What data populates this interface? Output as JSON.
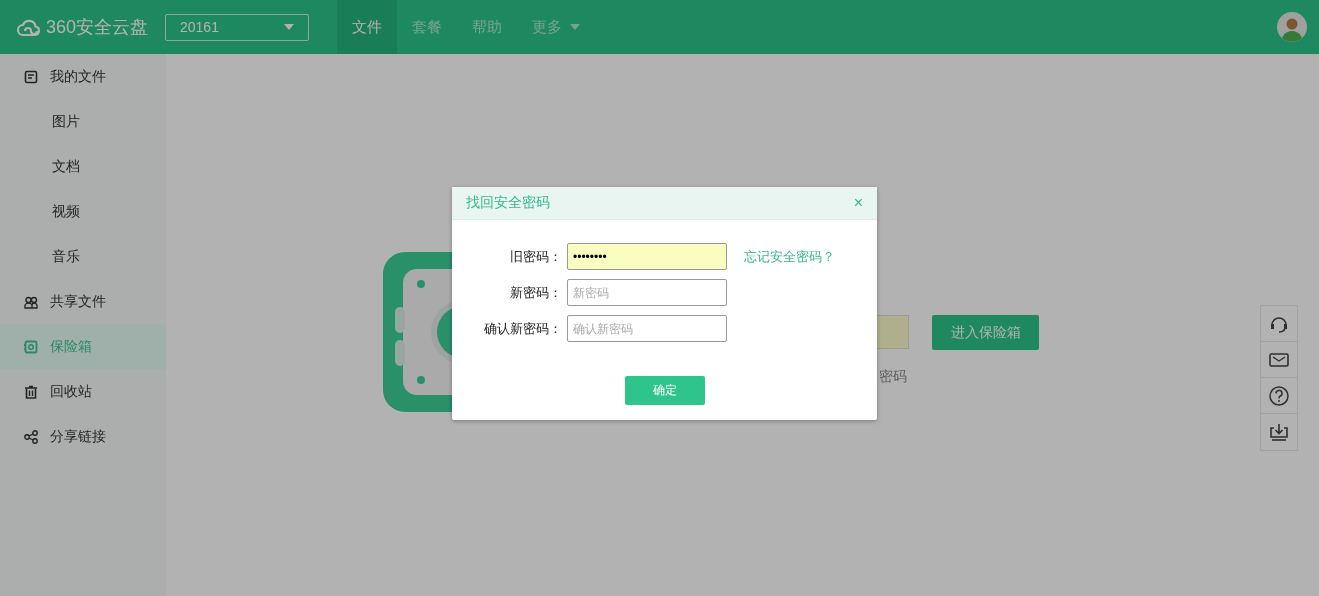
{
  "header": {
    "logo": "360安全云盘",
    "account_select": {
      "value": "20161"
    },
    "nav": [
      {
        "label": "文件",
        "selected": true,
        "has_menu": false
      },
      {
        "label": "套餐",
        "selected": false,
        "has_menu": false
      },
      {
        "label": "帮助",
        "selected": false,
        "has_menu": false
      },
      {
        "label": "更多",
        "selected": false,
        "has_menu": true
      }
    ]
  },
  "sidebar": {
    "items": [
      {
        "label": "我的文件",
        "kind": "file",
        "selected": false,
        "children": [
          {
            "label": "图片",
            "selected": false
          },
          {
            "label": "文档",
            "selected": false
          },
          {
            "label": "视频",
            "selected": false
          },
          {
            "label": "音乐",
            "selected": false
          }
        ]
      },
      {
        "label": "共享文件",
        "kind": "shared",
        "selected": false
      },
      {
        "label": "保险箱",
        "kind": "safe",
        "selected": true
      },
      {
        "label": "回收站",
        "kind": "trash",
        "selected": false
      },
      {
        "label": "分享链接",
        "kind": "share",
        "selected": false
      }
    ]
  },
  "vault": {
    "enter_button": "进入保险箱",
    "hint": "密码"
  },
  "dialog": {
    "title": "找回安全密码",
    "close": "×",
    "fields": [
      {
        "label": "旧密码：",
        "value": "••••••••",
        "autofilled": true
      },
      {
        "label": "新密码：",
        "placeholder": "新密码",
        "autofilled": false
      },
      {
        "label": "确认新密码：",
        "placeholder": "确认新密码",
        "autofilled": false
      }
    ],
    "link": "忘记安全密码？",
    "confirm": "确定"
  }
}
